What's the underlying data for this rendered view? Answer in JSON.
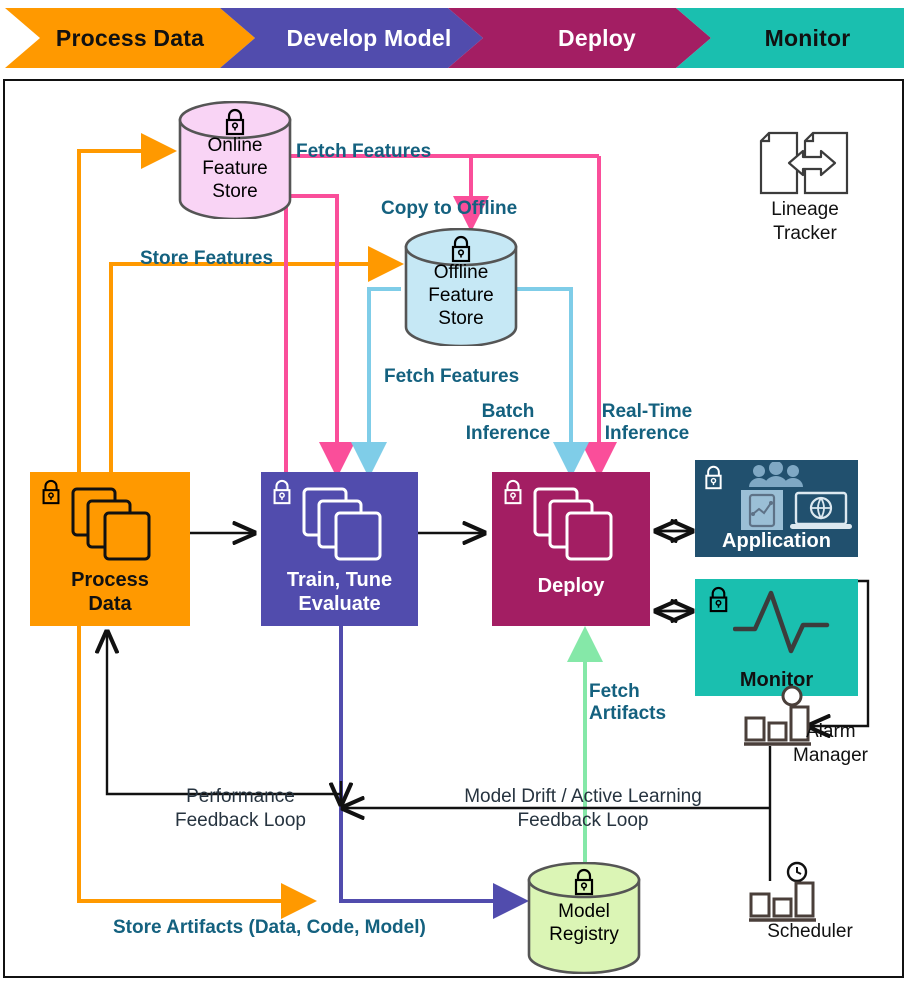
{
  "banner": {
    "stages": [
      {
        "label": "Process Data",
        "fill": "#FF9900",
        "text_color": "#111111"
      },
      {
        "label": "Develop Model",
        "fill": "#514CAD",
        "text_color": "#FFFFFF"
      },
      {
        "label": "Deploy",
        "fill": "#A31E63",
        "text_color": "#FFFFFF"
      },
      {
        "label": "Monitor",
        "fill": "#1ABFAF",
        "text_color": "#111111"
      }
    ]
  },
  "colors": {
    "orange": "#FF9900",
    "purple": "#514CAD",
    "magenta": "#A31E63",
    "teal": "#1ABFAF",
    "navy": "#21506E",
    "pink_line": "#FA4E9A",
    "cyan_line": "#7FCDE8",
    "green_line": "#85E8A8",
    "label_blue": "#14617F",
    "black": "#111111",
    "online_store_fill": "#F9D4F5",
    "offline_store_fill": "#C6E8F5",
    "model_registry_fill": "#DBF5B5"
  },
  "feature_stores": {
    "online": {
      "name": "Online Feature Store",
      "lines": [
        "Online",
        "Feature",
        "Store"
      ]
    },
    "offline": {
      "name": "Offline Feature Store",
      "lines": [
        "Offline",
        "Feature",
        "Store"
      ]
    }
  },
  "registry": {
    "name": "Model Registry",
    "lines": [
      "Model",
      "Registry"
    ]
  },
  "process_boxes": [
    {
      "id": "process-data",
      "lines": [
        "Process",
        "Data"
      ],
      "fill": "#FF9900",
      "text_color": "#111111"
    },
    {
      "id": "train-tune-evaluate",
      "lines": [
        "Train, Tune",
        "Evaluate"
      ],
      "fill": "#514CAD",
      "text_color": "#FFFFFF"
    },
    {
      "id": "deploy",
      "lines": [
        "Deploy"
      ],
      "fill": "#A31E63",
      "text_color": "#FFFFFF"
    }
  ],
  "side_boxes": [
    {
      "id": "application",
      "label": "Application",
      "fill": "#21506E",
      "text_color": "#FFFFFF"
    },
    {
      "id": "monitor",
      "label": "Monitor",
      "fill": "#1ABFAF",
      "text_color": "#111111"
    }
  ],
  "standalone_icons": [
    {
      "id": "lineage-tracker",
      "lines": [
        "Lineage",
        "Tracker"
      ]
    },
    {
      "id": "alarm-manager",
      "lines": [
        "Alarm",
        "Manager"
      ]
    },
    {
      "id": "scheduler",
      "lines": [
        "Scheduler"
      ]
    }
  ],
  "edge_labels": {
    "fetch_features_online": "Fetch Features",
    "copy_to_offline": "Copy to Offline",
    "store_features": "Store Features",
    "fetch_features_offline": "Fetch Features",
    "batch_inference": [
      "Batch",
      "Inference"
    ],
    "real_time_inference": [
      "Real-Time",
      "Inference"
    ],
    "fetch_artifacts": [
      "Fetch",
      "Artifacts"
    ],
    "performance_feedback_loop": [
      "Performance",
      "Feedback Loop"
    ],
    "model_drift_feedback_loop": [
      "Model Drift / Active Learning",
      "Feedback Loop"
    ],
    "store_artifacts": "Store Artifacts (Data, Code, Model)"
  }
}
